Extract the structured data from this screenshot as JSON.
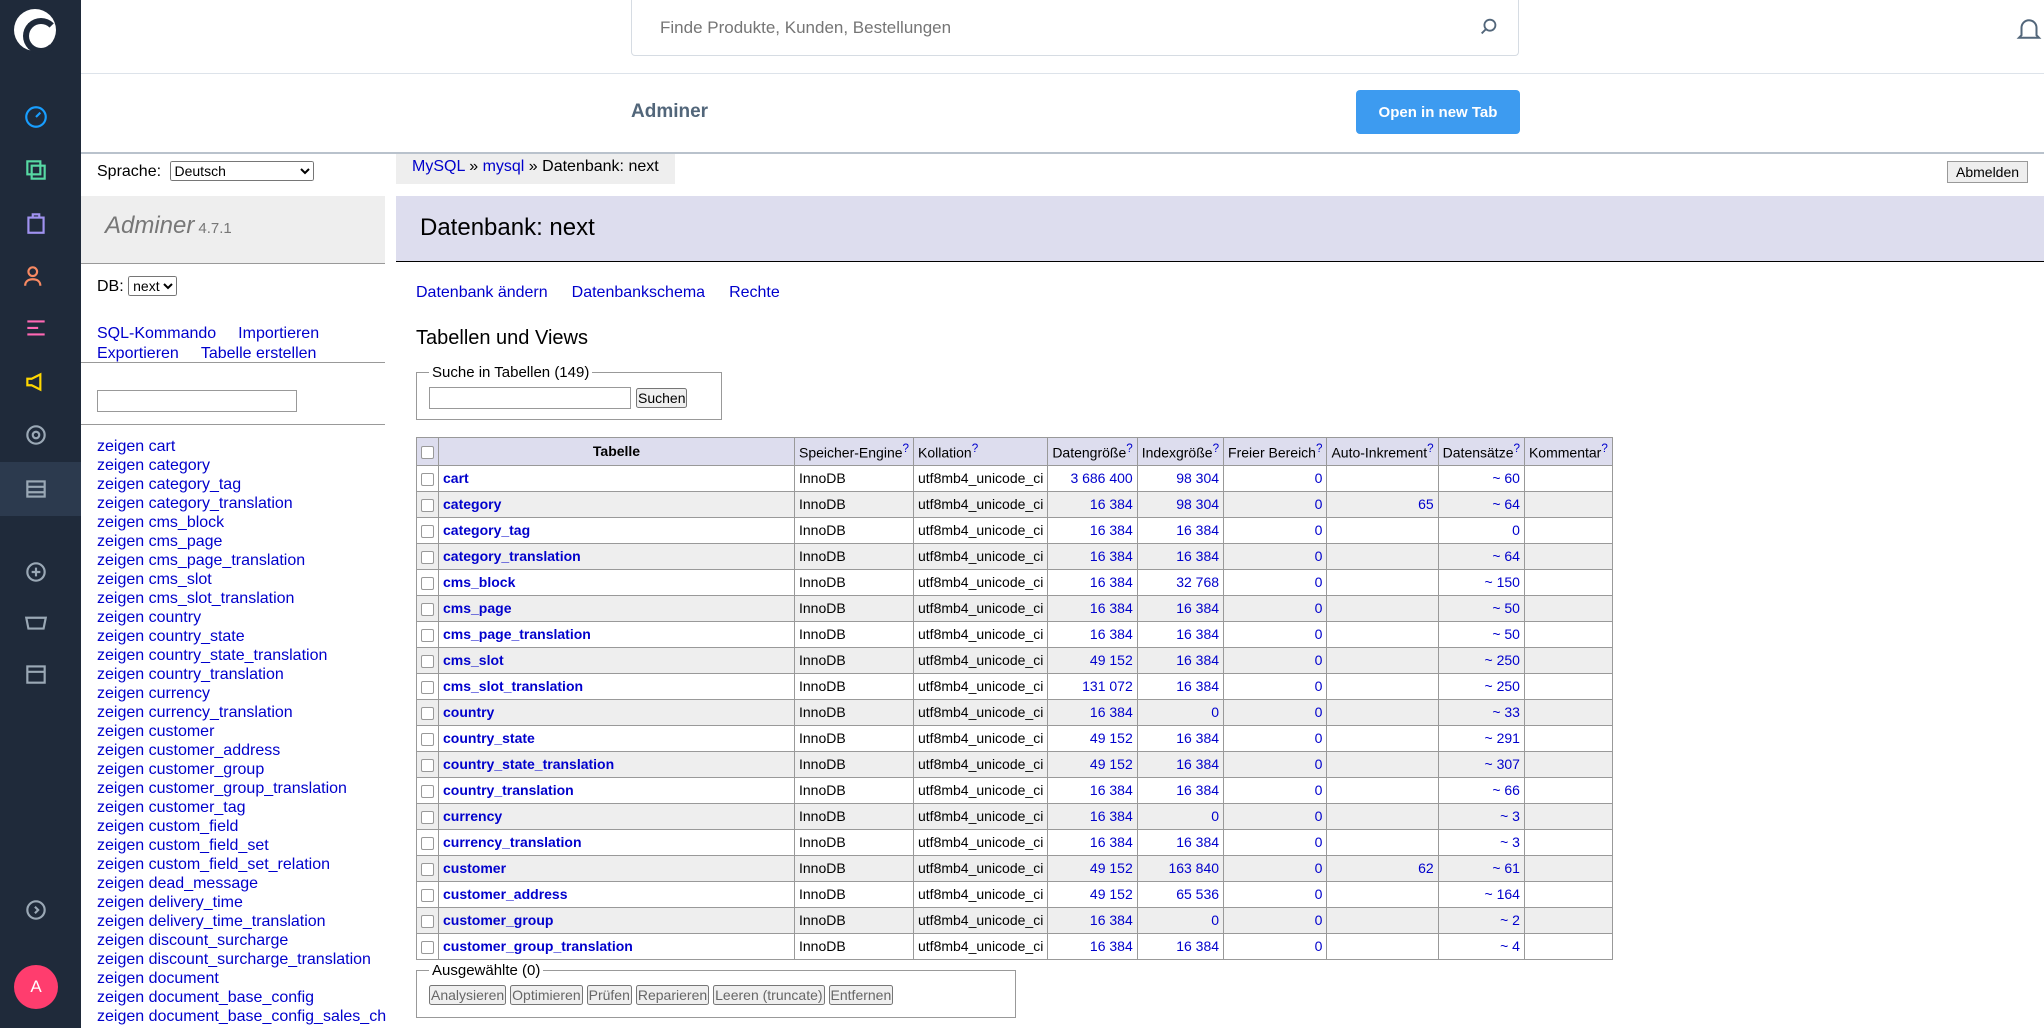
{
  "app": {
    "brand_color": "#1f2a3a",
    "accent": "#3d9bf0",
    "avatar": "A"
  },
  "search": {
    "placeholder": "Finde Produkte, Kunden, Bestellungen"
  },
  "header": {
    "title": "Adminer",
    "open_tab": "Open in new Tab"
  },
  "menu": {
    "lang_label": "Sprache:",
    "lang_value": "Deutsch",
    "name": "Adminer",
    "version": "4.7.1",
    "db_label": "DB:",
    "db_value": "next",
    "links": [
      "SQL-Kommando",
      "Importieren",
      "Exportieren",
      "Tabelle erstellen"
    ],
    "tables": [
      "zeigen cart",
      "zeigen category",
      "zeigen category_tag",
      "zeigen category_translation",
      "zeigen cms_block",
      "zeigen cms_page",
      "zeigen cms_page_translation",
      "zeigen cms_slot",
      "zeigen cms_slot_translation",
      "zeigen country",
      "zeigen country_state",
      "zeigen country_state_translation",
      "zeigen country_translation",
      "zeigen currency",
      "zeigen currency_translation",
      "zeigen customer",
      "zeigen customer_address",
      "zeigen customer_group",
      "zeigen customer_group_translation",
      "zeigen customer_tag",
      "zeigen custom_field",
      "zeigen custom_field_set",
      "zeigen custom_field_set_relation",
      "zeigen dead_message",
      "zeigen delivery_time",
      "zeigen delivery_time_translation",
      "zeigen discount_surcharge",
      "zeigen discount_surcharge_translation",
      "zeigen document",
      "zeigen document_base_config",
      "zeigen document_base_config_sales_ch"
    ]
  },
  "breadcrumb": {
    "a": "MySQL",
    "b": "mysql",
    "sep": "»",
    "c": "Datenbank: next"
  },
  "logout": "Abmelden",
  "page_title": "Datenbank: next",
  "content_links": [
    "Datenbank ändern",
    "Datenbankschema",
    "Rechte"
  ],
  "section_title": "Tabellen und Views",
  "search_tables": {
    "legend": "Suche in Tabellen (149)",
    "button": "Suchen"
  },
  "table": {
    "headers": [
      "Tabelle",
      "Speicher-Engine",
      "Kollation",
      "Datengröße",
      "Indexgröße",
      "Freier Bereich",
      "Auto-Inkrement",
      "Datensätze",
      "Kommentar"
    ],
    "rows": [
      [
        "cart",
        "InnoDB",
        "utf8mb4_unicode_ci",
        "3 686 400",
        "98 304",
        "0",
        "",
        "~ 60",
        ""
      ],
      [
        "category",
        "InnoDB",
        "utf8mb4_unicode_ci",
        "16 384",
        "98 304",
        "0",
        "65",
        "~ 64",
        ""
      ],
      [
        "category_tag",
        "InnoDB",
        "utf8mb4_unicode_ci",
        "16 384",
        "16 384",
        "0",
        "",
        "0",
        ""
      ],
      [
        "category_translation",
        "InnoDB",
        "utf8mb4_unicode_ci",
        "16 384",
        "16 384",
        "0",
        "",
        "~ 64",
        ""
      ],
      [
        "cms_block",
        "InnoDB",
        "utf8mb4_unicode_ci",
        "16 384",
        "32 768",
        "0",
        "",
        "~ 150",
        ""
      ],
      [
        "cms_page",
        "InnoDB",
        "utf8mb4_unicode_ci",
        "16 384",
        "16 384",
        "0",
        "",
        "~ 50",
        ""
      ],
      [
        "cms_page_translation",
        "InnoDB",
        "utf8mb4_unicode_ci",
        "16 384",
        "16 384",
        "0",
        "",
        "~ 50",
        ""
      ],
      [
        "cms_slot",
        "InnoDB",
        "utf8mb4_unicode_ci",
        "49 152",
        "16 384",
        "0",
        "",
        "~ 250",
        ""
      ],
      [
        "cms_slot_translation",
        "InnoDB",
        "utf8mb4_unicode_ci",
        "131 072",
        "16 384",
        "0",
        "",
        "~ 250",
        ""
      ],
      [
        "country",
        "InnoDB",
        "utf8mb4_unicode_ci",
        "16 384",
        "0",
        "0",
        "",
        "~ 33",
        ""
      ],
      [
        "country_state",
        "InnoDB",
        "utf8mb4_unicode_ci",
        "49 152",
        "16 384",
        "0",
        "",
        "~ 291",
        ""
      ],
      [
        "country_state_translation",
        "InnoDB",
        "utf8mb4_unicode_ci",
        "49 152",
        "16 384",
        "0",
        "",
        "~ 307",
        ""
      ],
      [
        "country_translation",
        "InnoDB",
        "utf8mb4_unicode_ci",
        "16 384",
        "16 384",
        "0",
        "",
        "~ 66",
        ""
      ],
      [
        "currency",
        "InnoDB",
        "utf8mb4_unicode_ci",
        "16 384",
        "0",
        "0",
        "",
        "~ 3",
        ""
      ],
      [
        "currency_translation",
        "InnoDB",
        "utf8mb4_unicode_ci",
        "16 384",
        "16 384",
        "0",
        "",
        "~ 3",
        ""
      ],
      [
        "customer",
        "InnoDB",
        "utf8mb4_unicode_ci",
        "49 152",
        "163 840",
        "0",
        "62",
        "~ 61",
        ""
      ],
      [
        "customer_address",
        "InnoDB",
        "utf8mb4_unicode_ci",
        "49 152",
        "65 536",
        "0",
        "",
        "~ 164",
        ""
      ],
      [
        "customer_group",
        "InnoDB",
        "utf8mb4_unicode_ci",
        "16 384",
        "0",
        "0",
        "",
        "~ 2",
        ""
      ],
      [
        "customer_group_translation",
        "InnoDB",
        "utf8mb4_unicode_ci",
        "16 384",
        "16 384",
        "0",
        "",
        "~ 4",
        ""
      ]
    ]
  },
  "selected": {
    "legend": "Ausgewählte (0)",
    "buttons": [
      "Analysieren",
      "Optimieren",
      "Prüfen",
      "Reparieren",
      "Leeren (truncate)",
      "Entfernen"
    ]
  }
}
